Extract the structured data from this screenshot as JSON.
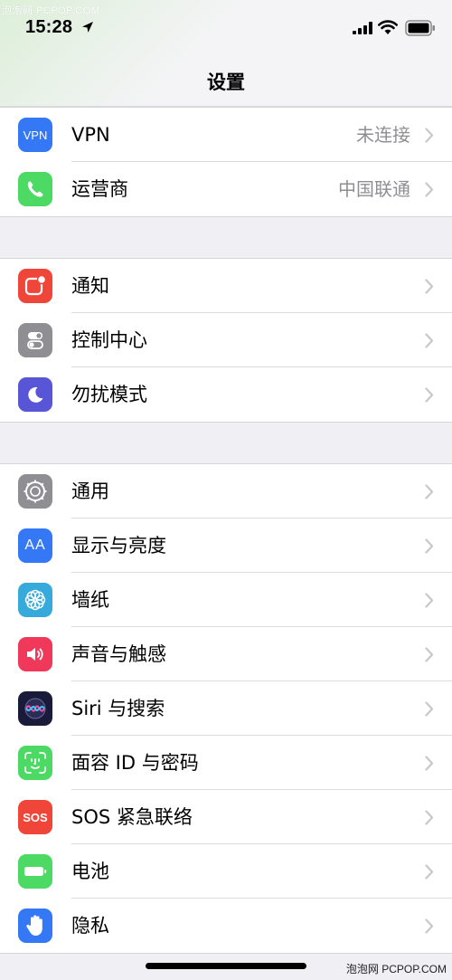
{
  "watermark_top": "泡泡网 PCPOP.COM",
  "watermark_bottom": "泡泡网 PCPOP.COM",
  "status_bar": {
    "time": "15:28",
    "icons": [
      "location-arrow-icon",
      "cellular-signal-icon",
      "wifi-icon",
      "battery-icon"
    ]
  },
  "header": {
    "title": "设置"
  },
  "groups": [
    {
      "items": [
        {
          "label": "VPN",
          "value": "未连接",
          "icon": "vpn-icon",
          "icon_text": "VPN",
          "color": "#3478f6"
        },
        {
          "label": "运营商",
          "value": "中国联通",
          "icon": "phone-icon",
          "color": "#4cd964"
        }
      ]
    },
    {
      "items": [
        {
          "label": "通知",
          "icon": "notifications-icon",
          "color": "#f0463a"
        },
        {
          "label": "控制中心",
          "icon": "control-center-icon",
          "color": "#8e8e93"
        },
        {
          "label": "勿扰模式",
          "icon": "moon-icon",
          "color": "#5856d6"
        }
      ]
    },
    {
      "items": [
        {
          "label": "通用",
          "icon": "gear-icon",
          "color": "#8e8e93"
        },
        {
          "label": "显示与亮度",
          "icon": "display-icon",
          "icon_text": "AA",
          "color": "#3478f6"
        },
        {
          "label": "墙纸",
          "icon": "wallpaper-icon",
          "color": "#37aadc"
        },
        {
          "label": "声音与触感",
          "icon": "speaker-icon",
          "color": "#f0385a"
        },
        {
          "label": "Siri 与搜索",
          "icon": "siri-icon",
          "color": "#1a1a3a"
        },
        {
          "label": "面容 ID 与密码",
          "icon": "face-id-icon",
          "color": "#4cd964"
        },
        {
          "label": "SOS 紧急联络",
          "icon": "sos-icon",
          "icon_text": "SOS",
          "color": "#f0463a"
        },
        {
          "label": "电池",
          "icon": "battery-icon",
          "color": "#4cd964"
        },
        {
          "label": "隐私",
          "icon": "hand-icon",
          "color": "#3478f6"
        }
      ]
    }
  ]
}
